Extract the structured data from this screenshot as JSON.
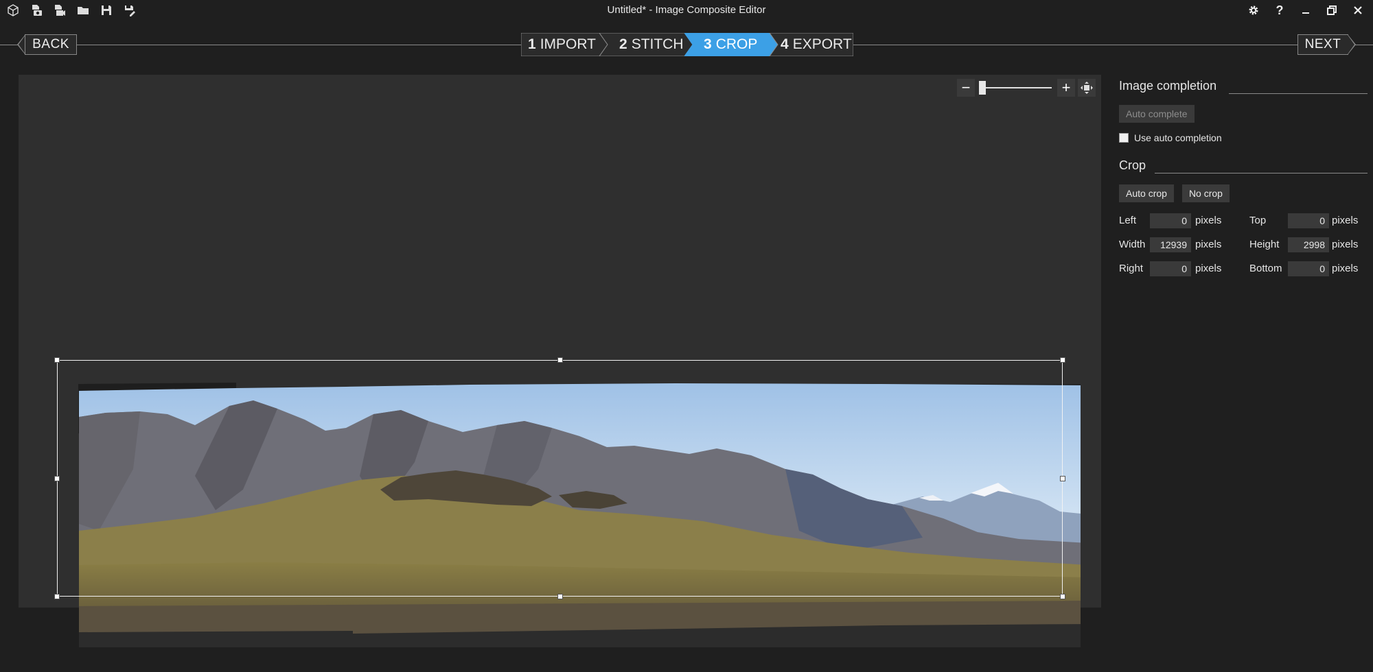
{
  "window": {
    "title": "Untitled* - Image Composite Editor"
  },
  "toolbar": {
    "icons": [
      "new-project-icon",
      "new-panorama-from-images-icon",
      "new-panorama-from-video-icon",
      "open-icon",
      "save-icon",
      "save-as-icon"
    ]
  },
  "window_controls": {
    "icons": [
      "settings-icon",
      "help-icon",
      "minimize-icon",
      "restore-icon",
      "close-icon"
    ],
    "help_label": "?"
  },
  "wizard": {
    "back_label": "BACK",
    "next_label": "NEXT",
    "steps": [
      {
        "num": "1",
        "label": "IMPORT"
      },
      {
        "num": "2",
        "label": "STITCH"
      },
      {
        "num": "3",
        "label": "CROP",
        "active": true
      },
      {
        "num": "4",
        "label": "EXPORT"
      }
    ],
    "active_color": "#3ca0e6"
  },
  "zoom": {
    "minus": "−",
    "plus": "+"
  },
  "panel": {
    "image_completion": {
      "title": "Image completion",
      "auto_complete_label": "Auto complete",
      "use_auto_label": "Use auto completion"
    },
    "crop": {
      "title": "Crop",
      "auto_crop_label": "Auto crop",
      "no_crop_label": "No crop",
      "fields": {
        "left": {
          "label": "Left",
          "value": "0",
          "unit": "pixels"
        },
        "top": {
          "label": "Top",
          "value": "0",
          "unit": "pixels"
        },
        "width": {
          "label": "Width",
          "value": "12939",
          "unit": "pixels"
        },
        "height": {
          "label": "Height",
          "value": "2998",
          "unit": "pixels"
        },
        "right": {
          "label": "Right",
          "value": "0",
          "unit": "pixels"
        },
        "bottom": {
          "label": "Bottom",
          "value": "0",
          "unit": "pixels"
        }
      }
    }
  }
}
